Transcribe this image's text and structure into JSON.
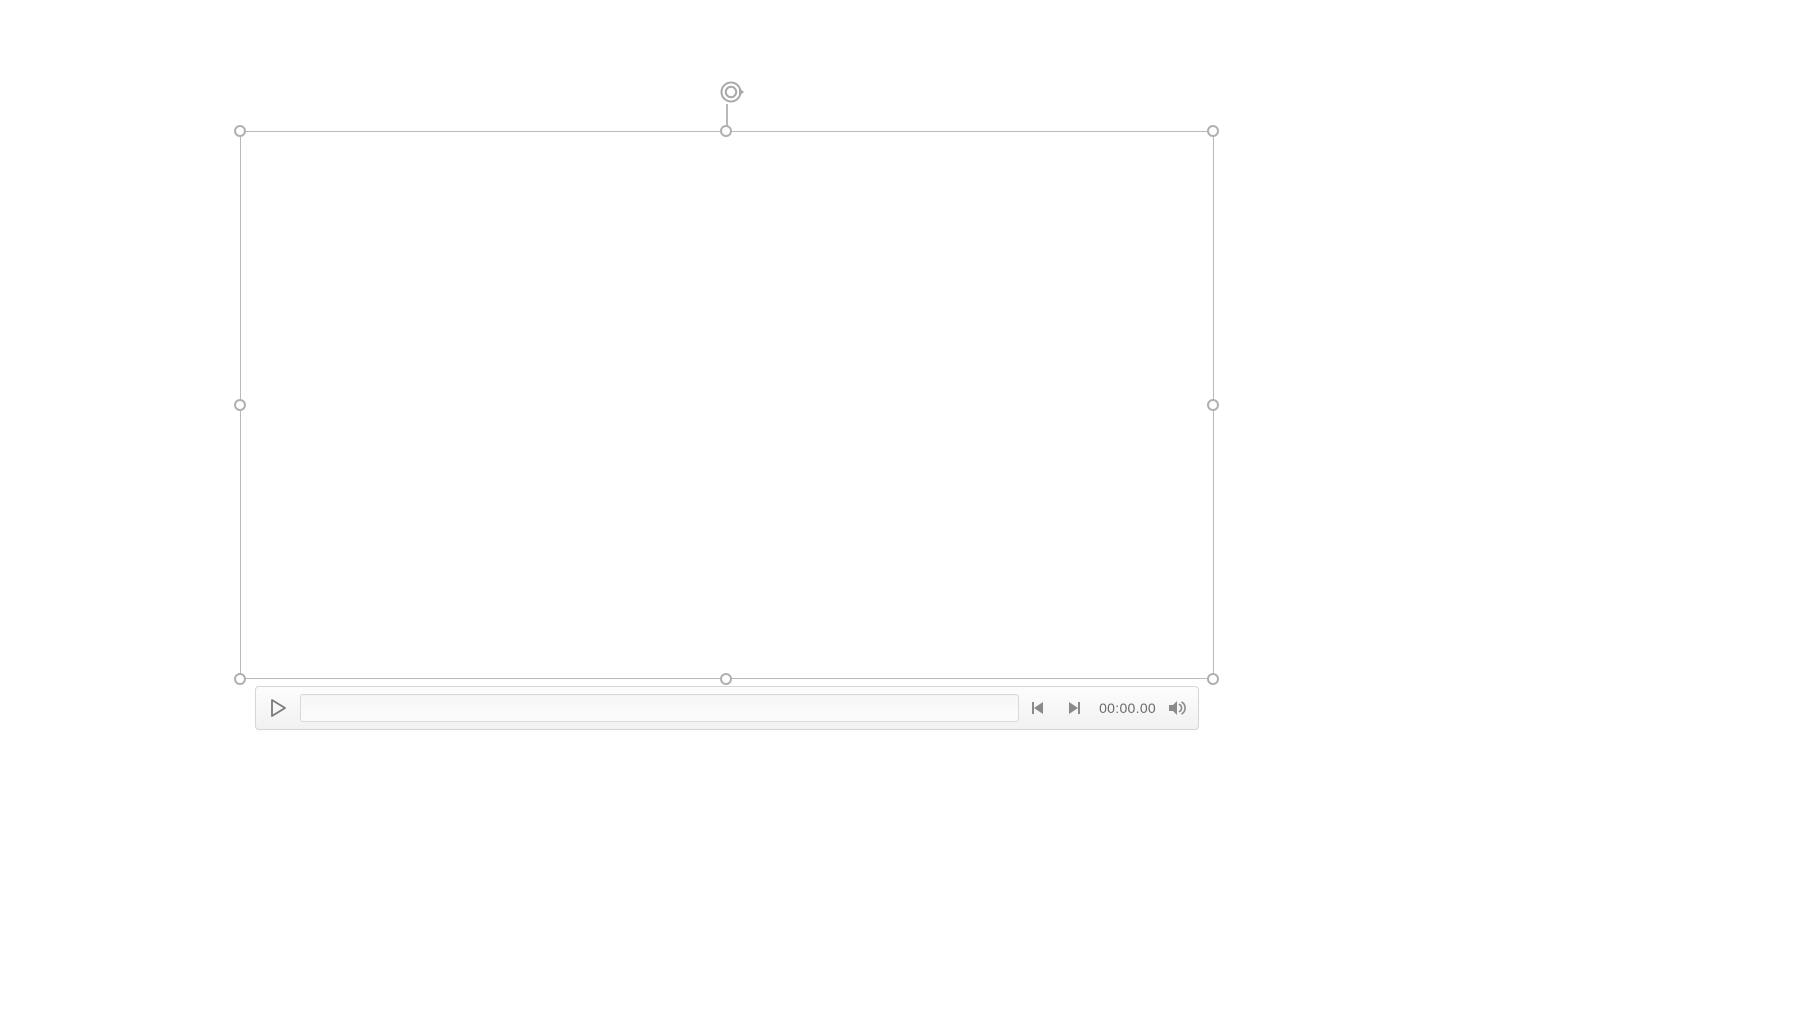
{
  "media_object": {
    "selected": true,
    "handles": 8
  },
  "player": {
    "playing": false,
    "time_display": "00:00.00",
    "icons": {
      "play": "play-icon",
      "step_back": "step-back-icon",
      "step_forward": "step-forward-icon",
      "volume": "volume-icon",
      "rotate": "rotate-icon"
    }
  },
  "colors": {
    "handle_border": "#b0b0b0",
    "frame_border": "#b9b9b9",
    "bar_border": "#d6d6d6",
    "bar_bg_top": "#fdfdfd",
    "bar_bg_bottom": "#f1f1f1",
    "track_border": "#d9d9d9",
    "icon_gray": "#7a7a7a",
    "time_text": "#6a6a6a"
  }
}
